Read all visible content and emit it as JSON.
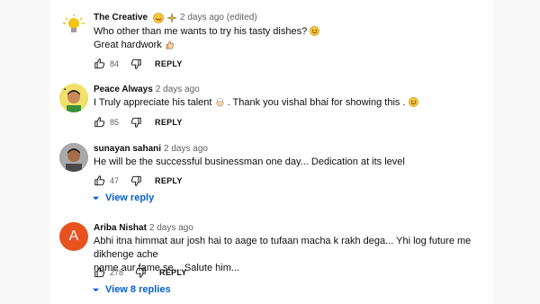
{
  "comments": [
    {
      "author": "The Creative",
      "meta": "2 days ago (edited)",
      "lines": [
        "Who other than me wants to try his tasty dishes?",
        "Great hardwork"
      ],
      "likes": "84",
      "reply_label": "REPLY"
    },
    {
      "author": "Peace Always",
      "meta": "2 days ago",
      "lines": [
        "I Truly appreciate his talent",
        ". Thank you vishal bhai for showing this ."
      ],
      "likes": "85",
      "reply_label": "REPLY"
    },
    {
      "author": "sunayan sahani",
      "meta": "2 days ago",
      "lines": [
        "He will be the successful businessman one day... Dedication at its level"
      ],
      "likes": "47",
      "reply_label": "REPLY",
      "view_replies": "View reply"
    },
    {
      "author": "Ariba Nishat",
      "meta": "2 days ago",
      "avatar_letter": "A",
      "lines": [
        "Abhi itna himmat aur josh hai to aage to tufaan macha k rakh dega... Yhi log future me dikhenge ache",
        "name aur fame se... Salute him..."
      ],
      "likes": "278",
      "reply_label": "REPLY",
      "view_replies": "View 8 replies"
    }
  ],
  "colors": {
    "link_blue": "#065fd4",
    "avatar_orange": "#e8521f",
    "meta_gray": "#606060"
  }
}
